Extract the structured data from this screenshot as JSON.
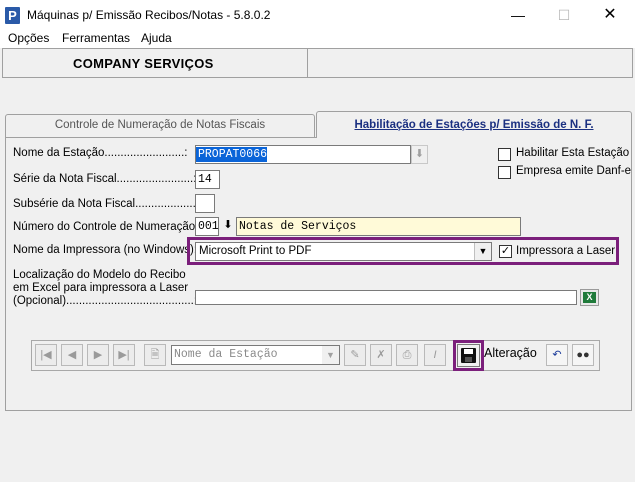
{
  "window": {
    "title": "Máquinas p/ Emissão Recibos/Notas - 5.8.0.2",
    "app_icon": "P"
  },
  "menu": [
    "Opções",
    "Ferramentas",
    "Ajuda"
  ],
  "company": "COMPANY SERVIÇOS",
  "tabs": {
    "controle": "Controle de Numeração de Notas Fiscais",
    "habilitacao": "Habilitação de Estações p/ Emissão de N. F."
  },
  "form": {
    "estacao_label": "Nome da Estação.........................:",
    "estacao_value": "PROPAT0066",
    "serie_label": "Série da Nota Fiscal........................:",
    "serie_value": "14",
    "subserie_label": "Subsérie da Nota Fiscal...................:",
    "subserie_value": "",
    "controle_label": "Número do Controle de Numeração:",
    "controle_code": "001",
    "controle_desc": "Notas de Serviços",
    "impressora_label": "Nome da Impressora (no Windows):",
    "impressora_value": "Microsoft Print to PDF",
    "impressora_laser": "Impressora a  Laser",
    "habilitar": "Habilitar Esta Estação",
    "danfe": "Empresa emite Danf-e",
    "modelo_label_1": "Localização do Modelo do Recibo",
    "modelo_label_2": "em Excel para impressora a Laser",
    "modelo_label_3": "(Opcional)........................................:",
    "modelo_value": ""
  },
  "toolbar": {
    "search_placeholder": "Nome da Estação",
    "mode": "Alteração"
  }
}
